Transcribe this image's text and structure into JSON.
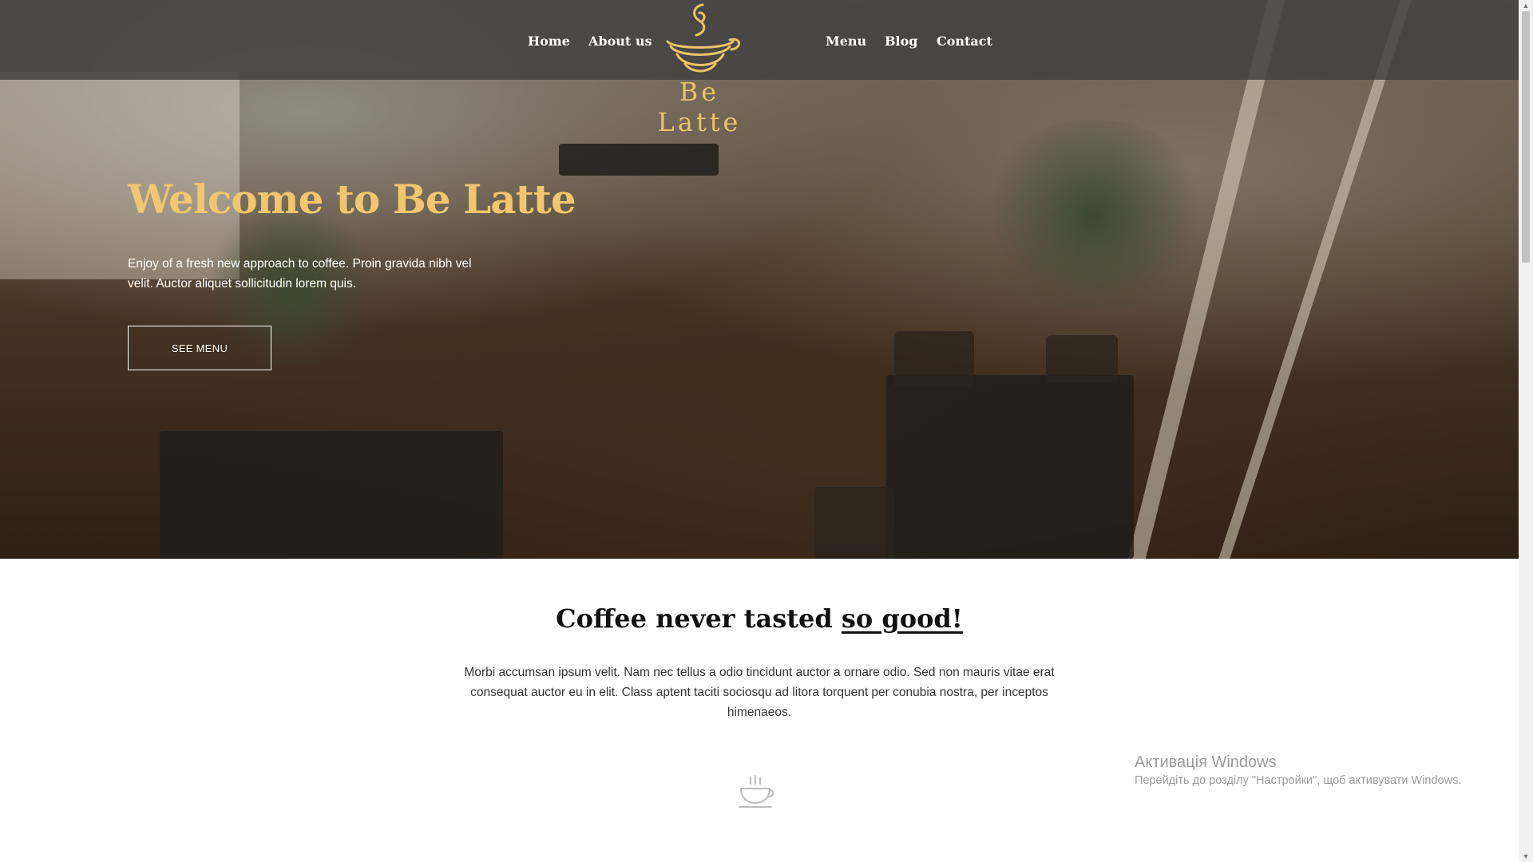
{
  "nav": {
    "links_left": [
      "Home",
      "About us"
    ],
    "links_right": [
      "Menu",
      "Blog",
      "Contact"
    ],
    "brand": "Be Latte"
  },
  "hero": {
    "title": "Welcome to Be Latte",
    "text": "Enjoy of a fresh new approach to coffee. Proin gravida nibh vel velit. Auctor aliquet sollicitudin lorem quis.",
    "button_label": "SEE MENU"
  },
  "intro": {
    "title_main": "Coffee never tasted ",
    "title_accent": "so good!",
    "text": "Morbi accumsan ipsum velit. Nam nec tellus a odio tincidunt auctor a ornare odio. Sed non mauris vitae erat consequat auctor eu in elit. Class aptent taciti sociosqu ad litora torquent per conubia nostra, per inceptos himenaeos."
  },
  "watermark": {
    "title": "Активація Windows",
    "subtitle": "Перейдіть до розділу \"Настройки\", щоб активувати Windows."
  },
  "colors": {
    "accent": "#f2c66d",
    "logo": "#e9c46a",
    "navbar": "#404040"
  },
  "icons": [
    "coffee-cup-logo-icon",
    "coffee-cup-icon"
  ]
}
